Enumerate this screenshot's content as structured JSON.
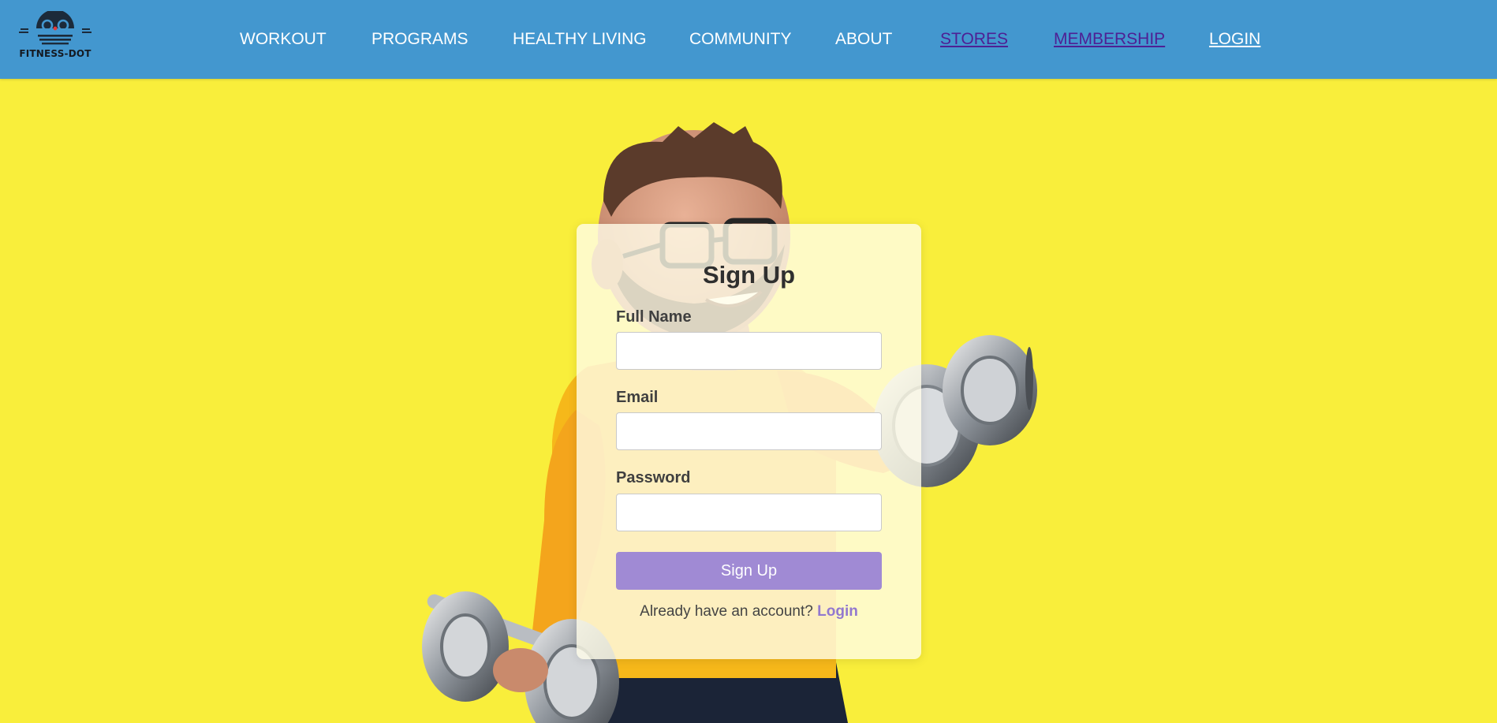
{
  "brand": {
    "name": "FITNESS-DOT",
    "logo_icon": "dumbbell-face-icon",
    "nav_bg_color": "#4397cf"
  },
  "nav": {
    "items": [
      {
        "label": "WORKOUT"
      },
      {
        "label": "PROGRAMS"
      },
      {
        "label": "HEALTHY LIVING"
      },
      {
        "label": "COMMUNITY"
      },
      {
        "label": "ABOUT"
      },
      {
        "label": "STORES"
      },
      {
        "label": "MEMBERSHIP"
      },
      {
        "label": "LOGIN"
      }
    ]
  },
  "background": {
    "color": "#f9ee3b",
    "illustration": "cartoon-man-lifting-dumbbells"
  },
  "form": {
    "title": "Sign Up",
    "fields": [
      {
        "label": "Full Name",
        "value": "",
        "placeholder": ""
      },
      {
        "label": "Email",
        "value": "",
        "placeholder": ""
      },
      {
        "label": "Password",
        "value": "",
        "placeholder": ""
      }
    ],
    "submit_label": "Sign Up",
    "submit_color": "#a08ad4",
    "footer_text": "Already have an account?",
    "footer_link": "Login"
  }
}
